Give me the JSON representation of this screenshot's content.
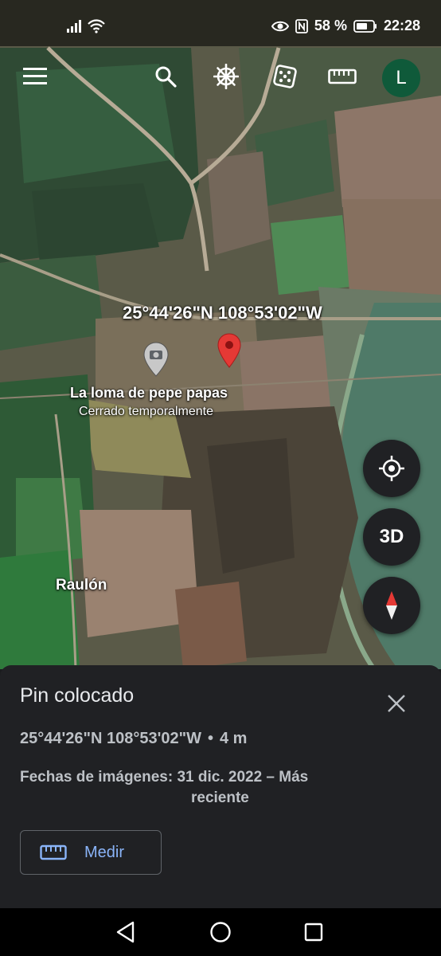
{
  "status_bar": {
    "battery_percent": "58 %",
    "time": "22:28",
    "icons": [
      "signal-icon",
      "wifi-icon",
      "eye-icon",
      "nfc-icon",
      "battery-icon"
    ]
  },
  "toolbar": {
    "icons": [
      "menu-icon",
      "search-icon",
      "voyager-icon",
      "random-dice-icon",
      "ruler-icon"
    ],
    "avatar_letter": "L"
  },
  "map": {
    "coordinate_label": "25°44'26\"N 108°53'02\"W",
    "place_name": "La loma de pepe papas",
    "place_status": "Cerrado temporalmente",
    "town_label": "Raulón",
    "controls": {
      "locate": "my-location-icon",
      "three_d": "3D",
      "compass": "compass-icon"
    },
    "colors": {
      "pin": "#e53935",
      "field_green": "#3a7a4a",
      "soil": "#9a7c6a"
    }
  },
  "sheet": {
    "title": "Pin colocado",
    "coords": "25°44'26\"N 108°53'02\"W",
    "separator": "•",
    "altitude": "4 m",
    "dates_line1": "Fechas de imágenes: 31 dic. 2022 – Más",
    "dates_line2": "reciente",
    "measure_label": "Medir",
    "accent": "#8ab4f8"
  },
  "navbar": {
    "icons": [
      "back-icon",
      "home-icon",
      "recents-icon"
    ]
  }
}
